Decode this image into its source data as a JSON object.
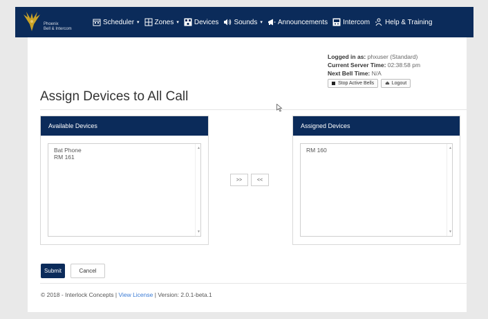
{
  "brand": {
    "line1": "Phoenix",
    "line2": "Bell & Intercom"
  },
  "nav": {
    "items": [
      {
        "label": "Scheduler",
        "icon": "calendar-icon",
        "dropdown": true
      },
      {
        "label": "Zones",
        "icon": "zones-icon",
        "dropdown": true
      },
      {
        "label": "Devices",
        "icon": "devices-icon",
        "dropdown": false
      },
      {
        "label": "Sounds",
        "icon": "speaker-icon",
        "dropdown": true
      },
      {
        "label": "Announcements",
        "icon": "megaphone-icon",
        "dropdown": false
      },
      {
        "label": "Intercom",
        "icon": "intercom-icon",
        "dropdown": false
      },
      {
        "label": "Help & Training",
        "icon": "help-icon",
        "dropdown": false
      }
    ]
  },
  "session": {
    "logged_in_label": "Logged in as:",
    "logged_in_value": "phxuser (Standard)",
    "server_time_label": "Current Server Time:",
    "server_time_value": "02:38:58 pm",
    "next_bell_label": "Next Bell Time:",
    "next_bell_value": "N/A",
    "stop_bells_label": "Stop Active Bells",
    "logout_label": "Logout"
  },
  "page": {
    "title": "Assign Devices to All Call"
  },
  "available": {
    "heading": "Available Devices",
    "items": [
      "Bat Phone",
      "RM 161"
    ]
  },
  "assigned": {
    "heading": "Assigned Devices",
    "items": [
      "RM 160"
    ]
  },
  "move": {
    "add_label": ">>",
    "remove_label": "<<"
  },
  "form": {
    "submit_label": "Submit",
    "cancel_label": "Cancel"
  },
  "footer": {
    "copyright": "© 2018 - Interlock Concepts |",
    "license_link": "View License",
    "version": "| Version: 2.0.1-beta.1"
  },
  "colors": {
    "navbar": "#0b2b5a",
    "link": "#3a7bd5",
    "background": "#e9e9e9"
  }
}
